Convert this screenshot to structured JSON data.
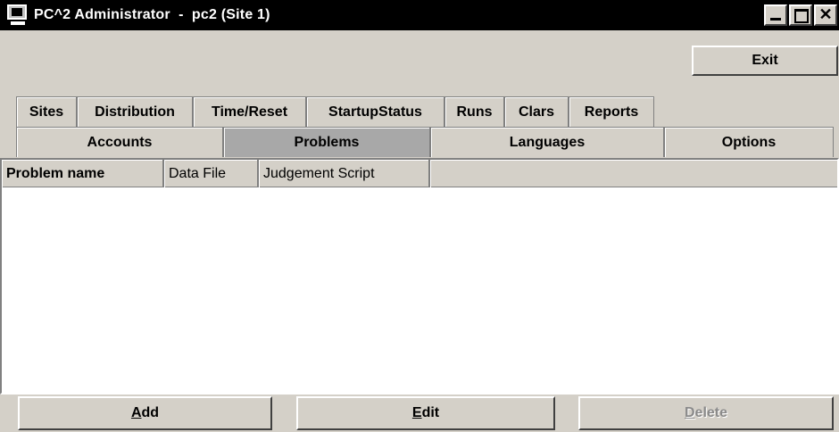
{
  "window": {
    "title": "PC^2 Administrator  -  pc2 (Site 1)"
  },
  "toolbar": {
    "exit_label": "Exit"
  },
  "tabs_row1": [
    {
      "label": "Sites"
    },
    {
      "label": "Distribution"
    },
    {
      "label": "Time/Reset"
    },
    {
      "label": "StartupStatus"
    },
    {
      "label": "Runs"
    },
    {
      "label": "Clars"
    },
    {
      "label": "Reports"
    }
  ],
  "tabs_row2": [
    {
      "label": "Accounts"
    },
    {
      "label": "Problems",
      "selected": true
    },
    {
      "label": "Languages"
    },
    {
      "label": "Options"
    }
  ],
  "table": {
    "columns": [
      {
        "label": "Problem name"
      },
      {
        "label": "Data File"
      },
      {
        "label": "Judgement Script"
      }
    ],
    "rows": []
  },
  "actions": {
    "add": {
      "mnemonic": "A",
      "rest": "dd",
      "enabled": true
    },
    "edit": {
      "mnemonic": "E",
      "rest": "dit",
      "enabled": true
    },
    "delete": {
      "mnemonic": "D",
      "rest": "elete",
      "enabled": false
    }
  },
  "icons": {
    "app": "pc2-computer-icon",
    "minimize": "minimize-icon",
    "maximize": "maximize-icon",
    "close": "close-icon"
  }
}
